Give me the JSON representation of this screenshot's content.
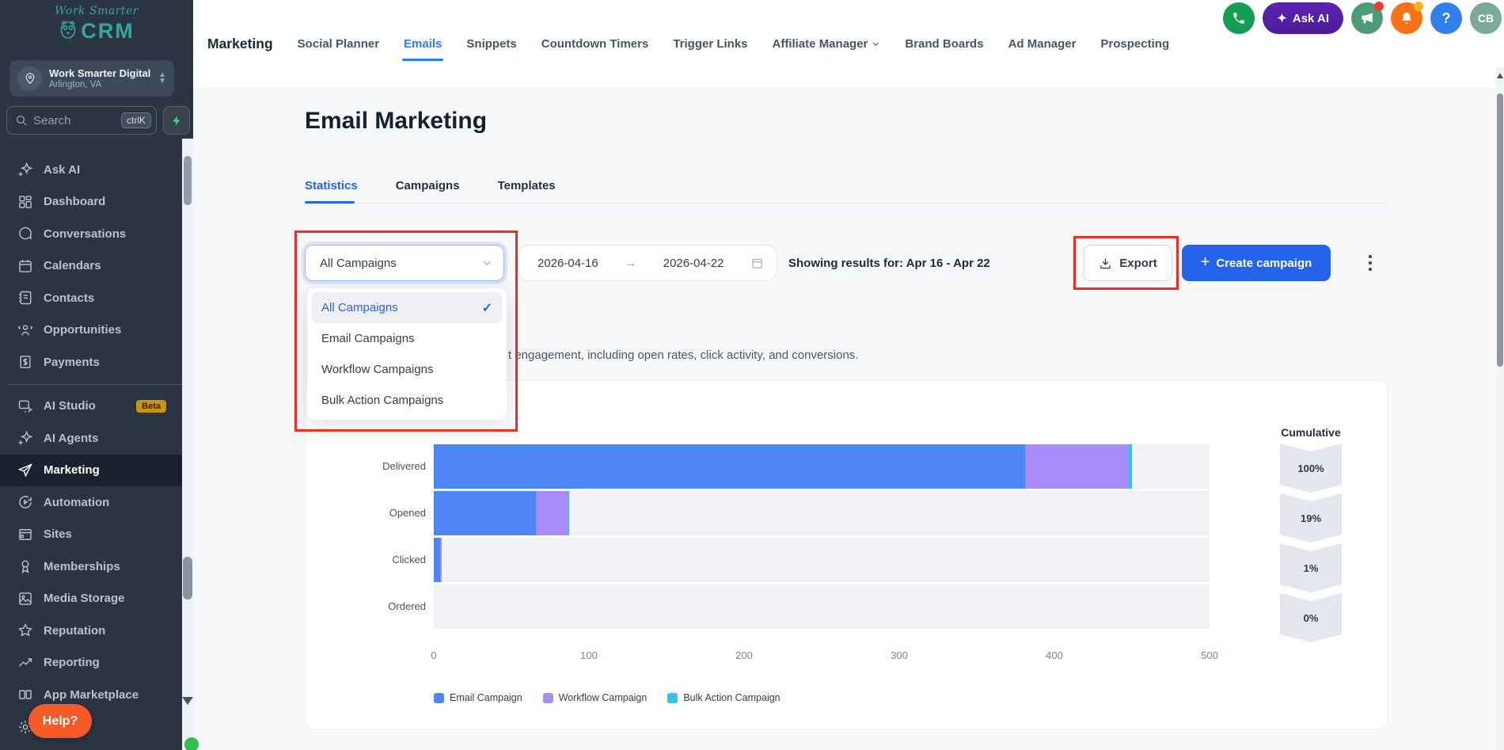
{
  "brand": {
    "line1": "Work Smarter",
    "line2": "CRM"
  },
  "org": {
    "name": "Work Smarter Digital",
    "location": "Arlington, VA"
  },
  "search": {
    "placeholder": "Search",
    "shortcut": "ctrlK"
  },
  "sidebar": {
    "primary": [
      {
        "label": "Ask AI"
      },
      {
        "label": "Dashboard"
      },
      {
        "label": "Conversations"
      },
      {
        "label": "Calendars"
      },
      {
        "label": "Contacts"
      },
      {
        "label": "Opportunities"
      },
      {
        "label": "Payments"
      }
    ],
    "secondary": [
      {
        "label": "AI Studio",
        "badge": "Beta"
      },
      {
        "label": "AI Agents"
      },
      {
        "label": "Marketing",
        "active": true
      },
      {
        "label": "Automation"
      },
      {
        "label": "Sites"
      },
      {
        "label": "Memberships"
      },
      {
        "label": "Media Storage"
      },
      {
        "label": "Reputation"
      },
      {
        "label": "Reporting"
      },
      {
        "label": "App Marketplace"
      },
      {
        "label": "Settings"
      }
    ],
    "help_label": "Help?"
  },
  "topnav": {
    "section": "Marketing",
    "items": [
      {
        "label": "Social Planner"
      },
      {
        "label": "Emails",
        "active": true
      },
      {
        "label": "Snippets"
      },
      {
        "label": "Countdown Timers"
      },
      {
        "label": "Trigger Links"
      },
      {
        "label": "Affiliate Manager",
        "has_chevron": true
      },
      {
        "label": "Brand Boards"
      },
      {
        "label": "Ad Manager"
      },
      {
        "label": "Prospecting"
      }
    ]
  },
  "topbar": {
    "ask_ai": "Ask AI",
    "help": "?",
    "avatar": "CB"
  },
  "page": {
    "title": "Email Marketing",
    "tabs": [
      {
        "label": "Statistics",
        "active": true
      },
      {
        "label": "Campaigns"
      },
      {
        "label": "Templates"
      }
    ],
    "subtitle_fragment": "t engagement, including open rates, click activity, and conversions."
  },
  "controls": {
    "campaign_filter": {
      "value": "All Campaigns",
      "options": [
        {
          "label": "All Campaigns",
          "selected": true
        },
        {
          "label": "Email Campaigns"
        },
        {
          "label": "Workflow Campaigns"
        },
        {
          "label": "Bulk Action Campaigns"
        }
      ]
    },
    "date_from": "2026-04-16",
    "date_to": "2026-04-22",
    "arrow": "→",
    "showing": "Showing results for: Apr 16 - Apr 22",
    "export_label": "Export",
    "create_label": "Create campaign"
  },
  "icons": {
    "sparkle": "✦",
    "sparkle_small": "✧",
    "check": "✓",
    "plus": "+"
  },
  "chart_data": {
    "type": "bar",
    "orientation": "horizontal",
    "title": "",
    "categories": [
      "Delivered",
      "Opened",
      "Clicked",
      "Ordered"
    ],
    "series": [
      {
        "name": "Email Campaign",
        "color": "#4d87f6",
        "values": [
          381,
          66,
          4,
          0
        ]
      },
      {
        "name": "Workflow Campaign",
        "color": "#a98cf8",
        "values": [
          67,
          20,
          1,
          0
        ]
      },
      {
        "name": "Bulk Action Campaign",
        "color": "#2fc5f3",
        "values": [
          2,
          1,
          0,
          0
        ]
      }
    ],
    "xlim": [
      0,
      500
    ],
    "xticks": [
      0,
      100,
      200,
      300,
      400,
      500
    ],
    "grid": false,
    "legend_position": "bottom",
    "cumulative_label": "Cumulative",
    "cumulative": [
      "100%",
      "19%",
      "1%",
      "0%"
    ]
  },
  "colors": {
    "accent_blue": "#2563eb",
    "annotation_red": "#ee2d24",
    "sidebar_bg": "#2b3442",
    "brand_teal": "#35a7a2",
    "help_orange": "#f65928",
    "badge_gray": "#e4e7ee"
  }
}
